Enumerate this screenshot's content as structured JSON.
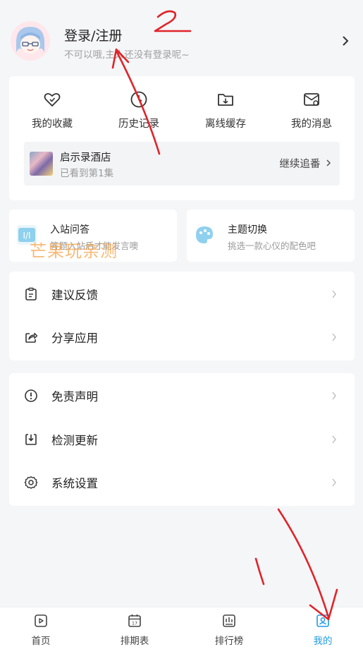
{
  "profile": {
    "title": "登录/注册",
    "subtitle": "不可以哦,主人还没有登录呢~"
  },
  "quick_actions": [
    {
      "label": "我的收藏",
      "icon": "heart-icon"
    },
    {
      "label": "历史记录",
      "icon": "clock-icon"
    },
    {
      "label": "离线缓存",
      "icon": "folder-download-icon"
    },
    {
      "label": "我的消息",
      "icon": "mail-icon"
    }
  ],
  "history": {
    "title": "启示录酒店",
    "subtitle": "已看到第1集",
    "action": "继续追番"
  },
  "cards": {
    "qa": {
      "title": "入站问答",
      "subtitle": "答题入站后才能发言噢",
      "icon": "qa-icon"
    },
    "theme": {
      "title": "主题切换",
      "subtitle": "挑选一款心仪的配色吧",
      "icon": "palette-icon"
    }
  },
  "watermark": "芒果玩亲测",
  "menu_group_1": [
    {
      "label": "建议反馈",
      "icon": "feedback-icon"
    },
    {
      "label": "分享应用",
      "icon": "share-icon"
    }
  ],
  "menu_group_2": [
    {
      "label": "免责声明",
      "icon": "info-icon"
    },
    {
      "label": "检测更新",
      "icon": "update-icon"
    },
    {
      "label": "系统设置",
      "icon": "settings-icon"
    }
  ],
  "bottom_nav": [
    {
      "label": "首页",
      "icon": "home-icon"
    },
    {
      "label": "排期表",
      "icon": "calendar-icon"
    },
    {
      "label": "排行榜",
      "icon": "ranking-icon"
    },
    {
      "label": "我的",
      "icon": "profile-icon",
      "active": true
    }
  ],
  "annotations": {
    "mark_1": "1",
    "mark_2": "2"
  },
  "colors": {
    "accent": "#1e9be4",
    "annotation": "#e0242a",
    "watermark": "#f5a348"
  }
}
